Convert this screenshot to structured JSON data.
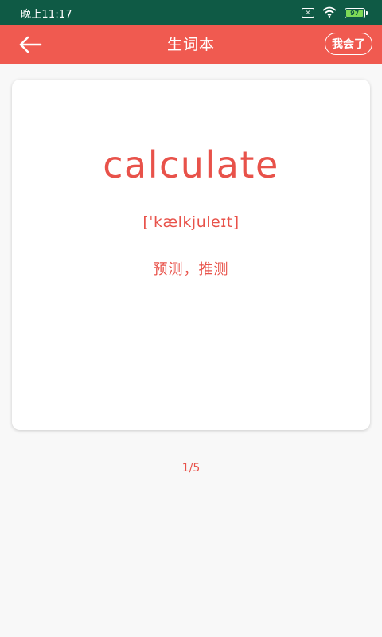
{
  "status_bar": {
    "time": "晚上11:17",
    "battery_level": "97",
    "sim_label": "×"
  },
  "header": {
    "title": "生词本",
    "known_label": "我会了",
    "back_icon": "arrow-left-icon"
  },
  "card": {
    "word": "calculate",
    "phonetic": "[ˈkælkjuleɪt]",
    "meaning": "预测，推测"
  },
  "pagination": {
    "label": "1/5"
  },
  "colors": {
    "accent": "#f05a50",
    "word": "#e8524a",
    "status_bar": "#0f5a45",
    "background": "#f8f8f8"
  }
}
